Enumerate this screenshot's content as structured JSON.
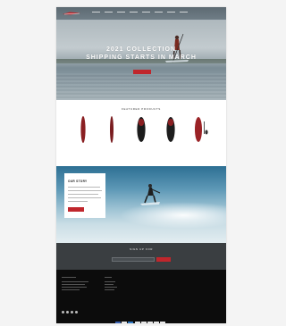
{
  "header": {
    "nav": [
      "",
      "",
      "",
      "",
      "",
      "",
      "",
      ""
    ]
  },
  "hero": {
    "title_line1": "2021 COLLECTION",
    "title_line2": "SHIPPING STARTS IN MARCH",
    "button_label": ""
  },
  "featured": {
    "title": "FEATURED PRODUCTS",
    "products": [
      {
        "color": "#8a1f22",
        "shape": "long",
        "caption": "",
        "price": ""
      },
      {
        "color": "#7a1d20",
        "shape": "narrow",
        "caption": "",
        "price": ""
      },
      {
        "color": "#1b1b1b",
        "shape": "wide",
        "caption": "",
        "price": ""
      },
      {
        "color": "#1d1d1d",
        "shape": "wide",
        "caption": "",
        "price": ""
      },
      {
        "color": "#9a2226",
        "shape": "kit",
        "caption": "",
        "price": ""
      }
    ]
  },
  "story": {
    "title": "OUR STORY",
    "button_label": ""
  },
  "newsletter": {
    "title": "SIGN UP FOR",
    "subtitle": "",
    "email_placeholder": "",
    "subscribe_label": ""
  },
  "footer": {
    "payment_colors": [
      "#3b63b5",
      "#e8e8e8",
      "#2f7ac8",
      "#e8e8e8",
      "#e8e8e8",
      "#e8e8e8",
      "#e8e8e8",
      "#e8e8e8"
    ]
  },
  "colors": {
    "accent": "#c0262c",
    "footer_bg": "#0c0c0c",
    "newsletter_bg": "#3a3e41"
  }
}
